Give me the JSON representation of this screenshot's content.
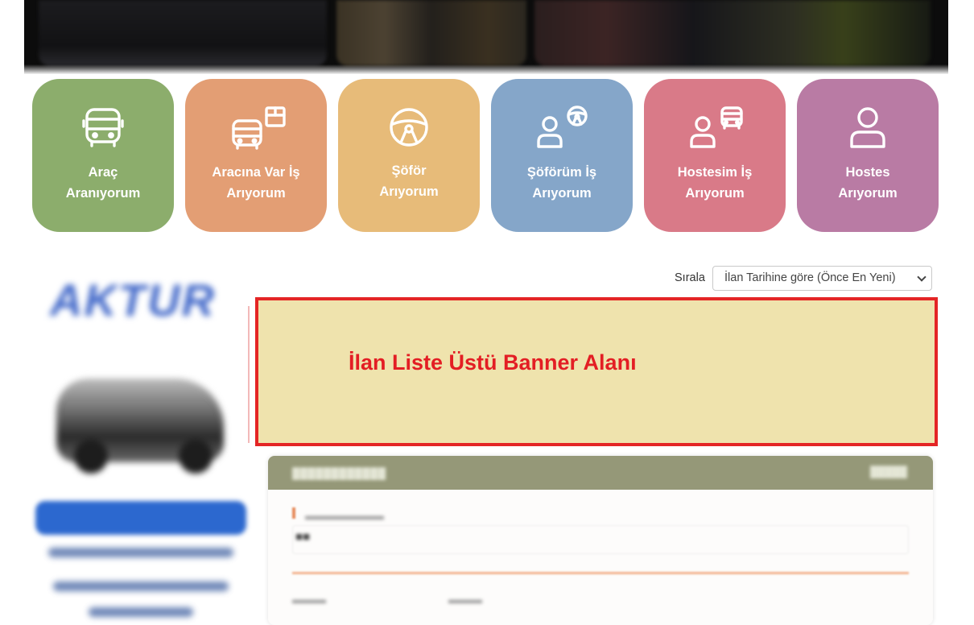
{
  "categories": [
    {
      "line1": "Araç",
      "line2": "Aranıyorum",
      "icon": "bus-icon",
      "color": "#8cad6c"
    },
    {
      "line1": "Aracına Var İş",
      "line2": "Arıyorum",
      "icon": "bus-box-icon",
      "color": "#e39e74"
    },
    {
      "line1": "Şöför",
      "line2": "Arıyorum",
      "icon": "steering-wheel-icon",
      "color": "#e7bb79"
    },
    {
      "line1": "Şöförüm İş",
      "line2": "Arıyorum",
      "icon": "driver-steering-icon",
      "color": "#85a6c9"
    },
    {
      "line1": "Hostesim İş",
      "line2": "Arıyorum",
      "icon": "person-bus-icon",
      "color": "#d97a88"
    },
    {
      "line1": "Hostes",
      "line2": "Arıyorum",
      "icon": "user-icon",
      "color": "#b97ba4"
    }
  ],
  "sort": {
    "label": "Sırala",
    "selected": "İlan Tarihine göre (Önce En Yeni)"
  },
  "banner": {
    "text": "İlan Liste Üstü Banner Alanı",
    "background": "#efe3ad",
    "border_color": "#e42525",
    "text_color": "#e31e24"
  }
}
